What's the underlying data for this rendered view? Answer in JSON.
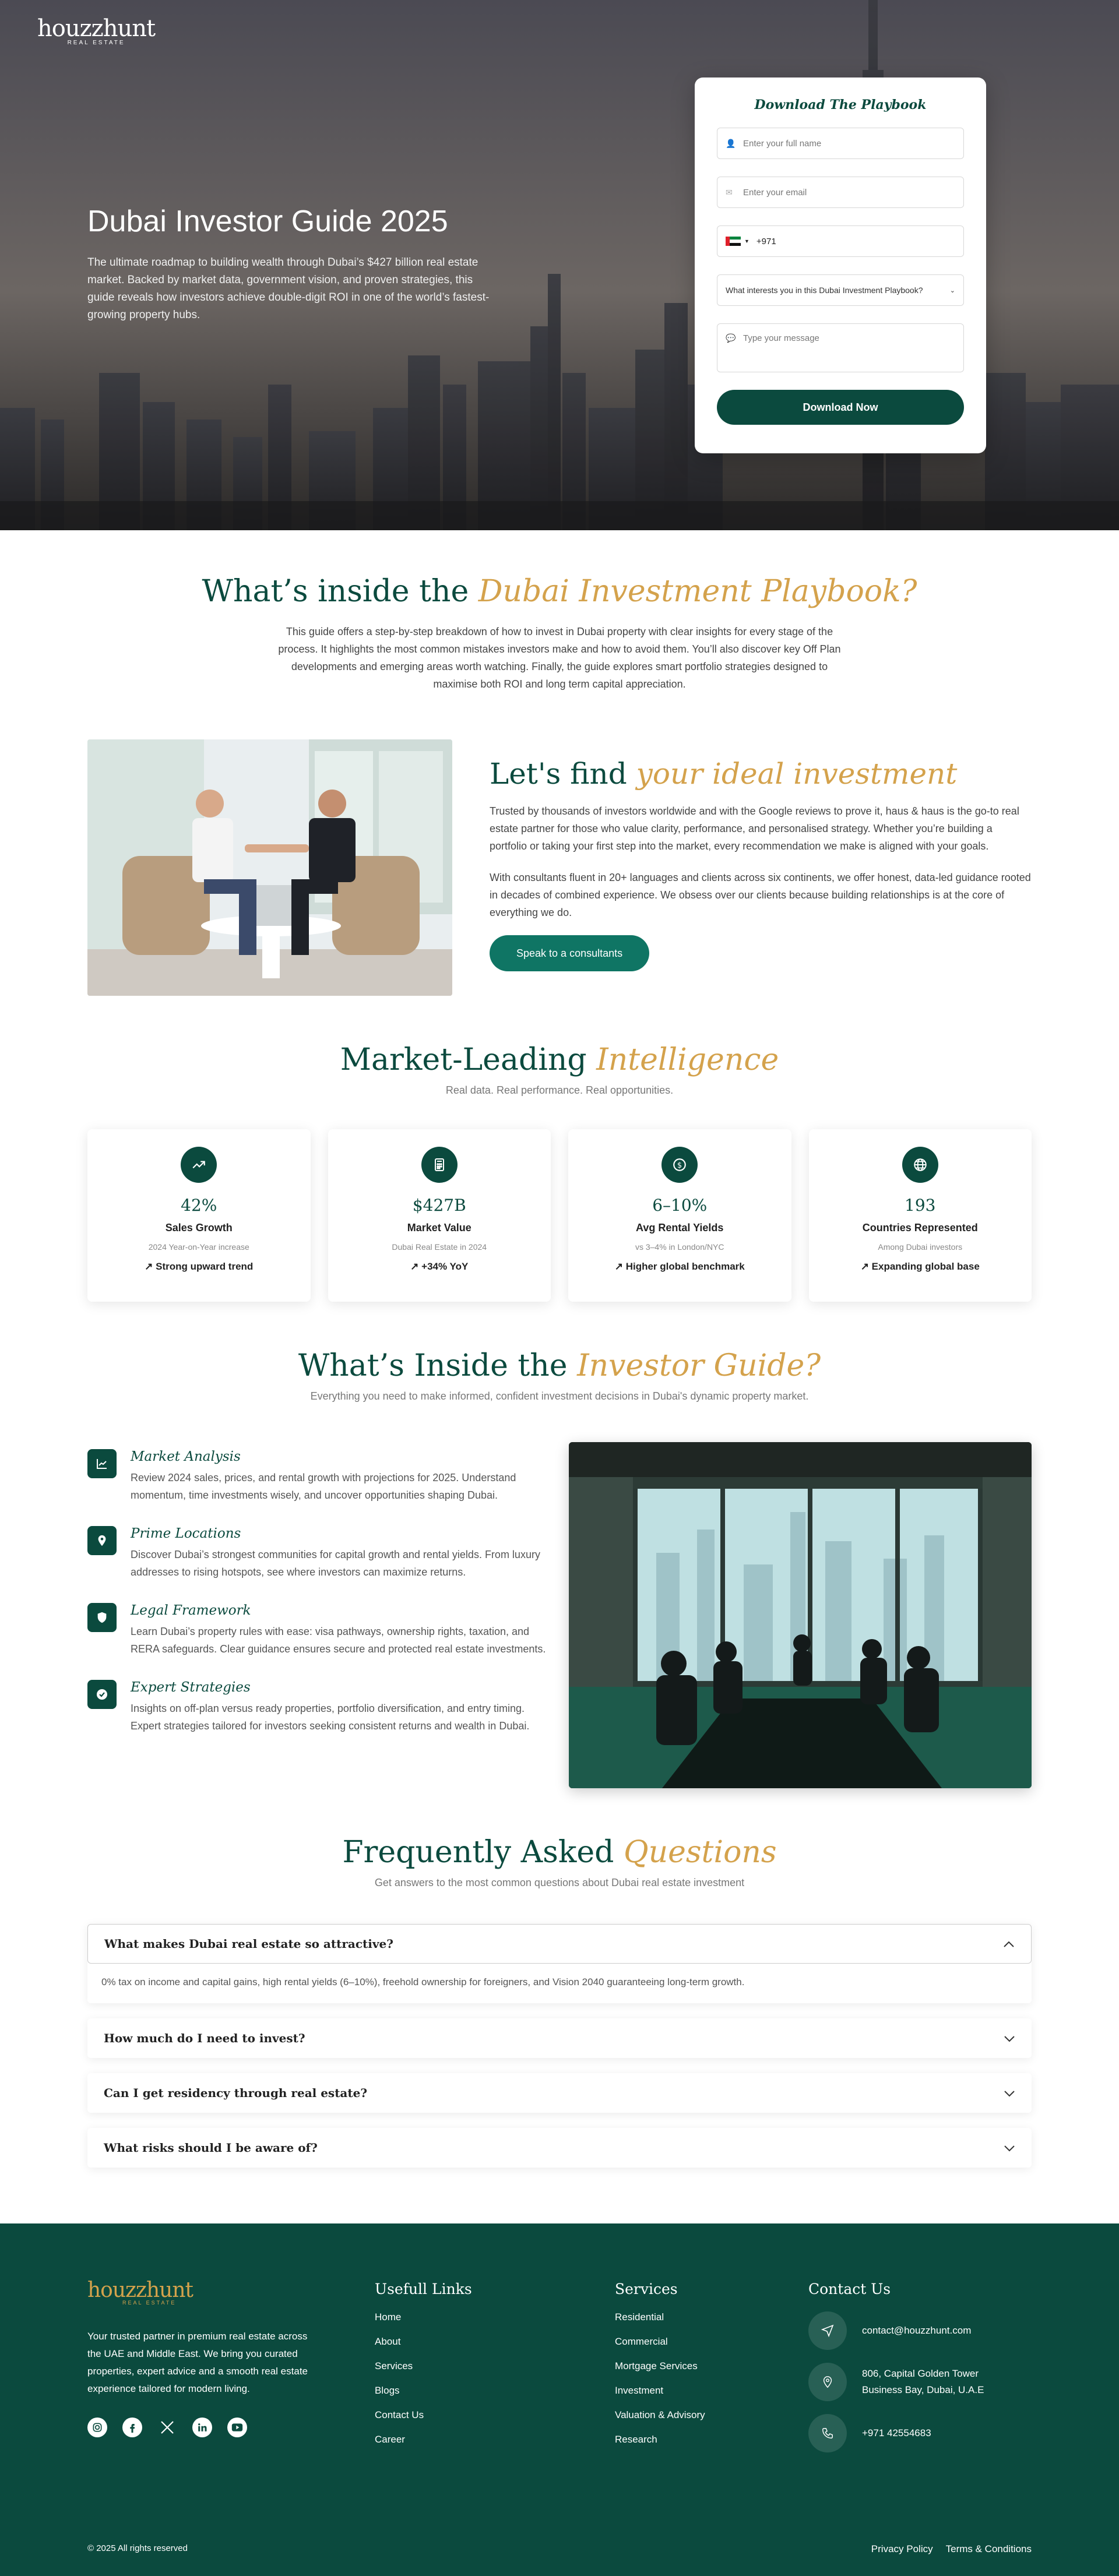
{
  "brand": {
    "name": "houzzhunt",
    "tagline": "REAL ESTATE"
  },
  "hero": {
    "title": "Dubai Investor Guide 2025",
    "description": "The ultimate roadmap to building wealth through Dubai’s $427 billion real estate market. Backed by market data, government vision, and proven strategies, this guide reveals how investors achieve double-digit ROI in one of the world’s fastest-growing property hubs."
  },
  "form": {
    "title": "Download The Playbook",
    "name_placeholder": "Enter your full name",
    "email_placeholder": "Enter your email",
    "phone_code": "+971",
    "interest_selected": "What interests you in this Dubai Investment Playbook?",
    "message_placeholder": "Type your message",
    "submit_label": "Download Now"
  },
  "inside": {
    "title_plain": "What’s inside the ",
    "title_accent": "Dubai Investment Playbook?",
    "body": "This guide offers a step-by-step breakdown of how to invest in Dubai property with clear insights for every stage of the process. It highlights the most common mistakes investors make and how to avoid them. You’ll also discover key Off Plan developments and emerging areas worth watching. Finally, the guide explores smart portfolio strategies designed to maximise both ROI and long term capital appreciation."
  },
  "find": {
    "title_plain": "Let's find ",
    "title_accent": "your ideal investment",
    "p1": "Trusted by thousands of investors worldwide and with the Google reviews to prove it, haus & haus is the go-to real estate partner for those who value clarity, performance, and personalised strategy. Whether you’re building a portfolio or taking your first step into the market, every recommendation we make is aligned with your goals.",
    "p2": "With consultants fluent in 20+ languages and clients across six continents, we offer honest, data-led guidance rooted in decades of combined experience. We obsess over our clients because building relationships is at the core of everything we do.",
    "cta": "Speak to a consultants"
  },
  "market": {
    "title_plain": "Market-Leading ",
    "title_accent": "Intelligence",
    "subtitle": "Real data. Real performance. Real opportunities.",
    "cards": [
      {
        "icon": "trending-up-icon",
        "value": "42%",
        "label": "Sales Growth",
        "note": "2024 Year-on-Year increase",
        "trend": "↗ Strong upward trend"
      },
      {
        "icon": "calculator-icon",
        "value": "$427B",
        "label": "Market Value",
        "note": "Dubai Real Estate in 2024",
        "trend": "↗ +34% YoY"
      },
      {
        "icon": "dollar-icon",
        "value": "6–10%",
        "label": "Avg Rental Yields",
        "note": "vs 3–4% in London/NYC",
        "trend": "↗ Higher global benchmark"
      },
      {
        "icon": "globe-icon",
        "value": "193",
        "label": "Countries Represented",
        "note": "Among Dubai investors",
        "trend": "↗ Expanding global base"
      }
    ]
  },
  "guide": {
    "title_plain": "What’s Inside the ",
    "title_accent": "Investor Guide?",
    "subtitle": "Everything you need to make informed, confident investment decisions in Dubai's dynamic property market.",
    "features": [
      {
        "icon": "chart-icon",
        "title": "Market Analysis",
        "text": "Review 2024 sales, prices, and rental growth with projections for 2025. Understand momentum, time investments wisely, and uncover opportunities shaping Dubai."
      },
      {
        "icon": "map-pin-icon",
        "title": "Prime Locations",
        "text": "Discover Dubai’s strongest communities for capital growth and rental yields. From luxury addresses to rising hotspots, see where investors can maximize returns."
      },
      {
        "icon": "shield-icon",
        "title": "Legal Framework",
        "text": "Learn Dubai’s property rules with ease: visa pathways, ownership rights, taxation, and RERA safeguards. Clear guidance ensures secure and protected real estate investments."
      },
      {
        "icon": "check-icon",
        "title": "Expert Strategies",
        "text": "Insights on off-plan versus ready properties, portfolio diversification, and entry timing. Expert strategies tailored for investors seeking consistent returns and wealth in Dubai."
      }
    ]
  },
  "faq": {
    "title_plain": "Frequently Asked ",
    "title_accent": "Questions",
    "subtitle": "Get answers to the most common questions about Dubai real estate investment",
    "items": [
      {
        "q": "What makes Dubai real estate so attractive?",
        "a": "0% tax on income and capital gains, high rental yields (6–10%), freehold ownership for foreigners, and Vision 2040 guaranteeing long-term growth."
      },
      {
        "q": "How much do I need to invest?"
      },
      {
        "q": "Can I get residency through real estate?"
      },
      {
        "q": "What risks should I be aware of?"
      }
    ]
  },
  "footer": {
    "description": "Your trusted partner in premium real estate across the UAE and Middle East. We bring you curated properties, expert advice and a smooth real estate experience tailored for modern living.",
    "useful_title": "Usefull Links",
    "useful": [
      "Home",
      "About",
      "Services",
      "Blogs",
      "Contact Us",
      "Career"
    ],
    "services_title": "Services",
    "services": [
      "Residential",
      "Commercial",
      "Mortgage Services",
      "Investment",
      "Valuation & Advisory",
      "Research"
    ],
    "contact_title": "Contact Us",
    "email": "contact@houzzhunt.com",
    "address1": "806, Capital Golden Tower",
    "address2": "Business Bay, Dubai, U.A.E",
    "phone": "+971 42554683",
    "copyright": "© 2025 All rights reserved",
    "privacy": "Privacy Policy",
    "terms": "Terms & Conditions"
  },
  "colors": {
    "primary": "#0b4a3e",
    "accent": "#d4a24c",
    "button": "#0f7564"
  }
}
